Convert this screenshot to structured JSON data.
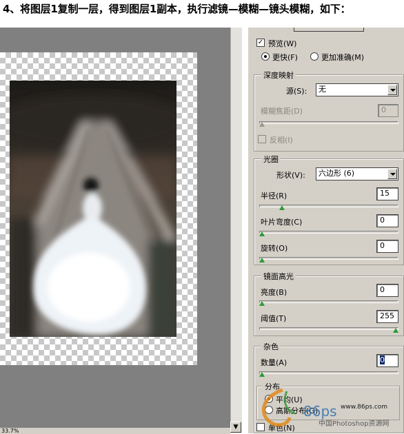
{
  "heading": "4、将图层1复制一层，得到图层1副本，执行滤镜—模糊—镜头模糊，如下：",
  "status": {
    "zoom": "33.7%"
  },
  "dialog": {
    "preview": {
      "label": "预览(W)",
      "checked": true
    },
    "speed": {
      "faster": "更快(F)",
      "accurate": "更加准确(M)",
      "selected": "faster"
    },
    "depth_map": {
      "title": "深度映射",
      "source_label": "源(S):",
      "source_value": "无",
      "blur_focal_label": "模糊焦距(D)",
      "blur_focal_value": "0",
      "invert_label": "反相(I)"
    },
    "iris": {
      "title": "光圈",
      "shape_label": "形状(V):",
      "shape_value": "六边形 (6)",
      "radius_label": "半径(R)",
      "radius_value": "15",
      "curvature_label": "叶片弯度(C)",
      "curvature_value": "0",
      "rotation_label": "旋转(O)",
      "rotation_value": "0"
    },
    "specular": {
      "title": "镜面高光",
      "brightness_label": "亮度(B)",
      "brightness_value": "0",
      "threshold_label": "阈值(T)",
      "threshold_value": "255"
    },
    "noise": {
      "title": "杂色",
      "amount_label": "数量(A)",
      "amount_value": "0",
      "distribution_title": "分布",
      "uniform_label": "平均(U)",
      "gaussian_label": "高斯分布(G)",
      "monochrome_label": "单色(N)"
    }
  },
  "levels": {
    "blur_focal": 0,
    "radius": 0.15,
    "curvature": 0,
    "rotation": 0,
    "brightness": 0,
    "threshold": 1,
    "amount": 0
  },
  "watermark": {
    "site": "www.86ps.com",
    "name": "中国Photoshop资源网",
    "logo_text": "86ps"
  }
}
